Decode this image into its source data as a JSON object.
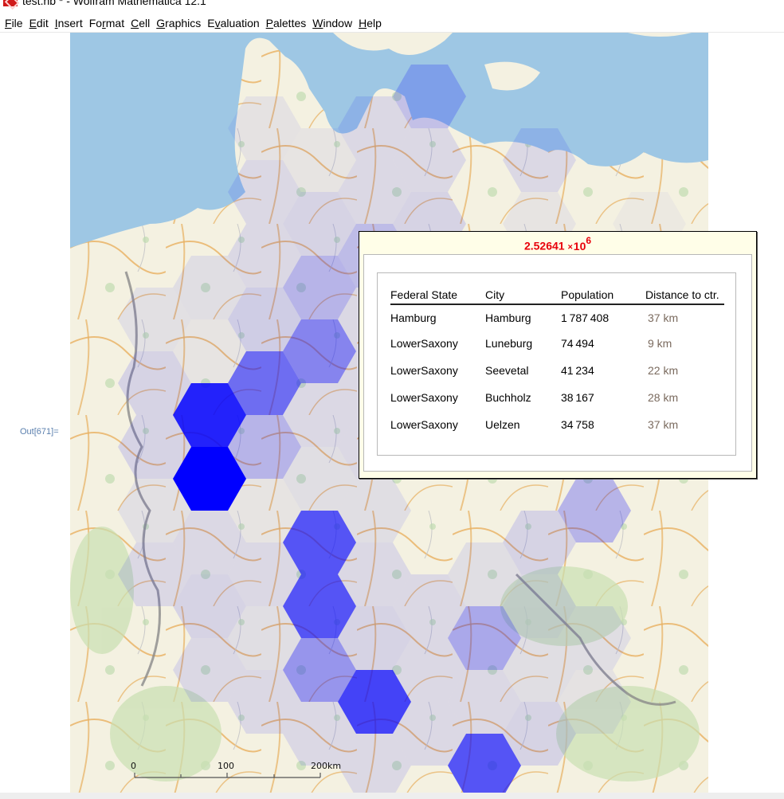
{
  "window": {
    "title": "test.nb * - Wolfram Mathematica 12.1",
    "app_icon": "wolfram-mathematica-icon"
  },
  "menubar": {
    "items": [
      {
        "label": "File",
        "accel": "F"
      },
      {
        "label": "Edit",
        "accel": "E"
      },
      {
        "label": "Insert",
        "accel": "I"
      },
      {
        "label": "Format",
        "accel": "r"
      },
      {
        "label": "Cell",
        "accel": "C"
      },
      {
        "label": "Graphics",
        "accel": "G"
      },
      {
        "label": "Evaluation",
        "accel": "v"
      },
      {
        "label": "Palettes",
        "accel": "P"
      },
      {
        "label": "Window",
        "accel": "W"
      },
      {
        "label": "Help",
        "accel": "H"
      }
    ]
  },
  "cell": {
    "output_label": "Out[671]="
  },
  "map": {
    "hex_color": "#0000ff",
    "scale": {
      "ticks": [
        "0",
        "100",
        "200km"
      ]
    },
    "hexes": [
      {
        "col": 0,
        "row": 5,
        "opacity": 0.07
      },
      {
        "col": 0,
        "row": 6,
        "opacity": 0.12
      },
      {
        "col": 0,
        "row": 7,
        "opacity": 0.12
      },
      {
        "col": 0,
        "row": 8,
        "opacity": 0.07
      },
      {
        "col": 0,
        "row": 9,
        "opacity": 0.1
      },
      {
        "col": 1,
        "row": 3,
        "opacity": 0.0
      },
      {
        "col": 1,
        "row": 4,
        "opacity": 0.08
      },
      {
        "col": 1,
        "row": 5,
        "opacity": 0.05
      },
      {
        "col": 1,
        "row": 6,
        "opacity": 0.86
      },
      {
        "col": 1,
        "row": 7,
        "opacity": 1.0
      },
      {
        "col": 1,
        "row": 8,
        "opacity": 0.1
      },
      {
        "col": 1,
        "row": 9,
        "opacity": 0.12
      },
      {
        "col": 1,
        "row": 10,
        "opacity": 0.1
      },
      {
        "col": 2,
        "row": 2,
        "opacity": 0.06
      },
      {
        "col": 2,
        "row": 3,
        "opacity": 0.1
      },
      {
        "col": 2,
        "row": 4,
        "opacity": 0.1
      },
      {
        "col": 2,
        "row": 5,
        "opacity": 0.15
      },
      {
        "col": 2,
        "row": 6,
        "opacity": 0.55
      },
      {
        "col": 2,
        "row": 7,
        "opacity": 0.25
      },
      {
        "col": 2,
        "row": 8,
        "opacity": 0.05
      },
      {
        "col": 2,
        "row": 9,
        "opacity": 0.1
      },
      {
        "col": 2,
        "row": 10,
        "opacity": 0.08
      },
      {
        "col": 2,
        "row": 11,
        "opacity": 0.1
      },
      {
        "col": 3,
        "row": 2,
        "opacity": 0.05
      },
      {
        "col": 3,
        "row": 3,
        "opacity": 0.12
      },
      {
        "col": 3,
        "row": 4,
        "opacity": 0.25
      },
      {
        "col": 3,
        "row": 5,
        "opacity": 0.45
      },
      {
        "col": 3,
        "row": 6,
        "opacity": 0.1
      },
      {
        "col": 3,
        "row": 7,
        "opacity": 0.08
      },
      {
        "col": 3,
        "row": 8,
        "opacity": 0.65
      },
      {
        "col": 3,
        "row": 9,
        "opacity": 0.65
      },
      {
        "col": 3,
        "row": 10,
        "opacity": 0.38
      },
      {
        "col": 3,
        "row": 11,
        "opacity": 0.1
      },
      {
        "col": 4,
        "row": 2,
        "opacity": 0.1
      },
      {
        "col": 4,
        "row": 3,
        "opacity": 0.1
      },
      {
        "col": 4,
        "row": 4,
        "opacity": 0.22
      },
      {
        "col": 4,
        "row": 5,
        "opacity": 0.1
      },
      {
        "col": 4,
        "row": 6,
        "opacity": 0.1
      },
      {
        "col": 4,
        "row": 7,
        "opacity": 0.1
      },
      {
        "col": 4,
        "row": 8,
        "opacity": 0.08
      },
      {
        "col": 4,
        "row": 9,
        "opacity": 0.1
      },
      {
        "col": 4,
        "row": 10,
        "opacity": 0.12
      },
      {
        "col": 4,
        "row": 11,
        "opacity": 0.72
      },
      {
        "col": 4,
        "row": 12,
        "opacity": 0.1
      },
      {
        "col": 5,
        "row": 1,
        "opacity": 0.2
      },
      {
        "col": 5,
        "row": 2,
        "opacity": 0.1
      },
      {
        "col": 5,
        "row": 3,
        "opacity": 0.12
      },
      {
        "col": 5,
        "row": 4,
        "opacity": 0.6
      },
      {
        "col": 5,
        "row": 5,
        "opacity": 0.12
      },
      {
        "col": 5,
        "row": 9,
        "opacity": 0.1
      },
      {
        "col": 5,
        "row": 10,
        "opacity": 0.1
      },
      {
        "col": 5,
        "row": 11,
        "opacity": 0.1
      },
      {
        "col": 6,
        "row": 9,
        "opacity": 0.08
      },
      {
        "col": 6,
        "row": 10,
        "opacity": 0.3
      },
      {
        "col": 6,
        "row": 11,
        "opacity": 0.1
      },
      {
        "col": 6,
        "row": 12,
        "opacity": 0.65
      },
      {
        "col": 7,
        "row": 2,
        "opacity": 0.1
      },
      {
        "col": 7,
        "row": 3,
        "opacity": 0.05
      },
      {
        "col": 7,
        "row": 8,
        "opacity": 0.12
      },
      {
        "col": 7,
        "row": 9,
        "opacity": 0.1
      },
      {
        "col": 7,
        "row": 10,
        "opacity": 0.08
      },
      {
        "col": 7,
        "row": 11,
        "opacity": 0.12
      },
      {
        "col": 8,
        "row": 8,
        "opacity": 0.25
      },
      {
        "col": 8,
        "row": 10,
        "opacity": 0.08
      },
      {
        "col": 8,
        "row": 11,
        "opacity": 0.06
      },
      {
        "col": 9,
        "row": 3,
        "opacity": 0.03
      }
    ]
  },
  "tooltip": {
    "value_mantissa": "2.52641",
    "value_times": "×",
    "value_base": "10",
    "value_exponent": "6",
    "value_color": "#e8000b",
    "headers": [
      "Federal State",
      "City",
      "Population",
      "Distance to ctr."
    ],
    "rows": [
      {
        "state": "Hamburg",
        "city": "Hamburg",
        "population": "1 787 408",
        "distance": "37 km"
      },
      {
        "state": "LowerSaxony",
        "city": "Luneburg",
        "population": "74 494",
        "distance": "9 km"
      },
      {
        "state": "LowerSaxony",
        "city": "Seevetal",
        "population": "41 234",
        "distance": "22 km"
      },
      {
        "state": "LowerSaxony",
        "city": "Buchholz",
        "population": "38 167",
        "distance": "28 km"
      },
      {
        "state": "LowerSaxony",
        "city": "Uelzen",
        "population": "34 758",
        "distance": "37 km"
      }
    ]
  }
}
